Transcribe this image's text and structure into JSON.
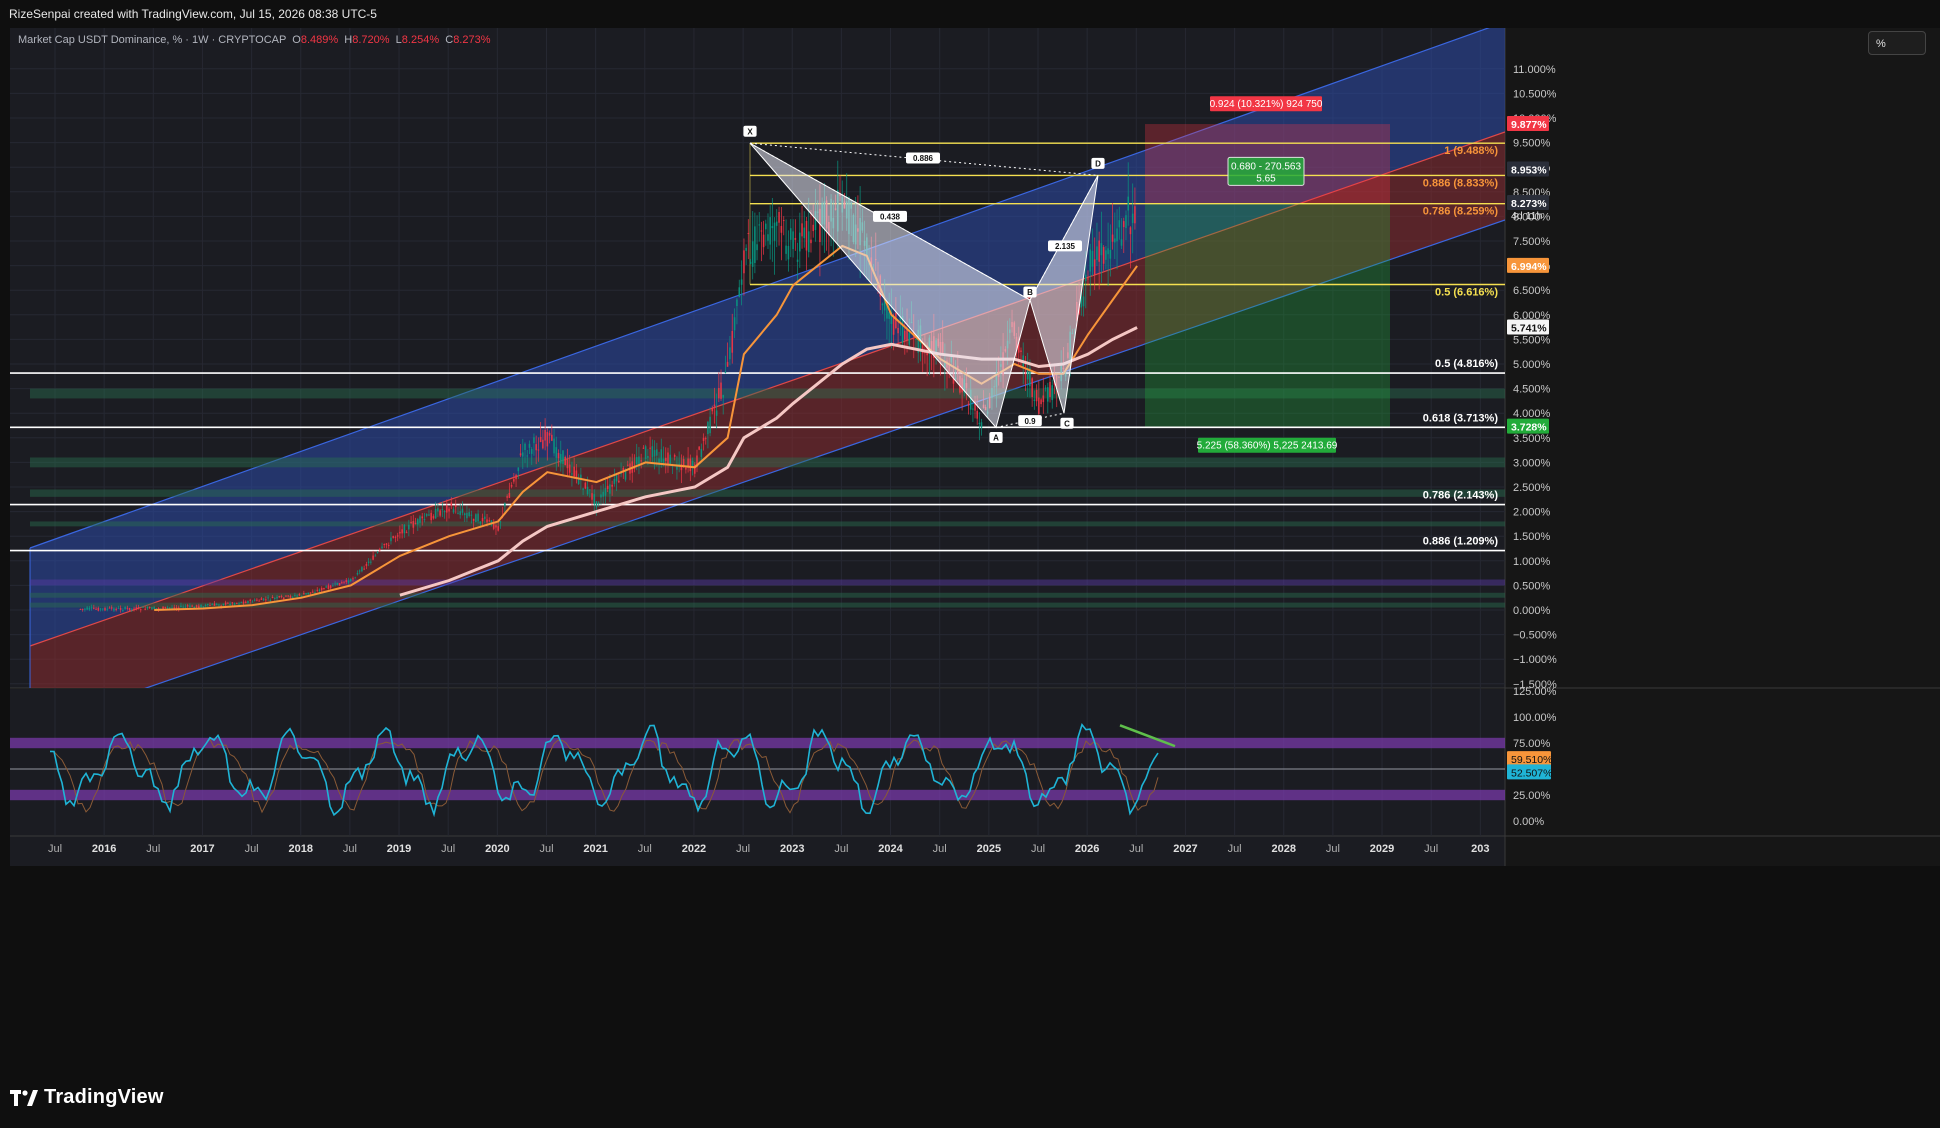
{
  "header": {
    "credit": "RizeSenpai created with TradingView.com, Jul 15, 2026 08:38 UTC-5"
  },
  "legend": {
    "symbol": "Market Cap USDT Dominance, % · 1W · CRYPTOCAP",
    "o_label": "O",
    "o": "8.489%",
    "h_label": "H",
    "h": "8.720%",
    "l_label": "L",
    "l": "8.254%",
    "c_label": "C",
    "c": "8.273%"
  },
  "scale_button": "%",
  "footer": {
    "brand": "TradingView"
  },
  "colors": {
    "background": "#1b1c22",
    "up": "#089981",
    "down": "#f23645",
    "channel_upper": "#2c4ba8",
    "channel_lower": "#8b2b2f",
    "ma_fast": "#f7953a",
    "ma_slow": "#f5c7c4",
    "fib": "#f5e050",
    "rsi": "#1fb4d6",
    "rsi_band": "#7e3ab0"
  },
  "chart_data": {
    "type": "line",
    "title": "Market Cap USDT Dominance, % · 1W · CRYPTOCAP",
    "x": [
      "2015-10",
      "2016-01",
      "2016-07",
      "2017-01",
      "2017-07",
      "2018-01",
      "2018-07",
      "2019-01",
      "2019-07",
      "2020-01",
      "2020-04",
      "2020-07",
      "2021-01",
      "2021-07",
      "2022-01",
      "2022-05",
      "2022-07",
      "2022-11",
      "2023-01",
      "2023-07",
      "2023-10",
      "2024-01",
      "2024-07",
      "2024-12",
      "2025-01",
      "2025-04",
      "2025-07",
      "2025-10",
      "2026-01",
      "2026-04",
      "2026-07"
    ],
    "series": [
      {
        "values": [
          0.02,
          0.02,
          0.03,
          0.08,
          0.18,
          0.3,
          0.6,
          1.6,
          2.1,
          1.7,
          3.2,
          3.5,
          2.2,
          3.2,
          2.9,
          4.8,
          7.2,
          7.8,
          7.4,
          8.2,
          7.5,
          5.8,
          5.3,
          3.9,
          4.2,
          5.7,
          4.1,
          4.8,
          6.9,
          7.5,
          8.27
        ]
      },
      {
        "values": [
          null,
          null,
          0.0,
          0.03,
          0.1,
          0.25,
          0.5,
          1.1,
          1.5,
          1.8,
          2.4,
          2.8,
          2.6,
          3.0,
          2.9,
          3.5,
          5.2,
          6.0,
          6.6,
          7.4,
          7.2,
          6.0,
          5.1,
          4.6,
          4.7,
          5.0,
          4.8,
          4.8,
          5.6,
          6.3,
          6.994
        ]
      },
      {
        "values": [
          null,
          null,
          null,
          null,
          null,
          null,
          null,
          0.3,
          0.6,
          1.0,
          1.4,
          1.7,
          2.0,
          2.3,
          2.5,
          2.9,
          3.5,
          3.9,
          4.2,
          5.0,
          5.3,
          5.4,
          5.2,
          5.1,
          5.1,
          5.1,
          4.95,
          5.0,
          5.2,
          5.5,
          5.741
        ]
      }
    ],
    "y_ticks": [
      "11.000%",
      "10.500%",
      "10.000%",
      "9.500%",
      "9.000%",
      "8.500%",
      "8.000%",
      "7.500%",
      "7.000%",
      "6.500%",
      "6.000%",
      "5.500%",
      "5.000%",
      "4.500%",
      "4.000%",
      "3.500%",
      "3.000%",
      "2.500%",
      "2.000%",
      "1.500%",
      "1.000%",
      "0.500%",
      "0.000%",
      "−0.500%",
      "−1.000%",
      "−1.500%"
    ],
    "x_ticks": [
      "Jul",
      "2016",
      "Jul",
      "2017",
      "Jul",
      "2018",
      "Jul",
      "2019",
      "Jul",
      "2020",
      "Jul",
      "2021",
      "Jul",
      "2022",
      "Jul",
      "2023",
      "Jul",
      "2024",
      "Jul",
      "2025",
      "Jul",
      "2026",
      "Jul",
      "2027",
      "Jul",
      "2028",
      "Jul",
      "2029",
      "Jul",
      "203"
    ],
    "price_badges": [
      {
        "value": 9.877,
        "text": "9.877%",
        "color": "#f23645"
      },
      {
        "value": 8.953,
        "text": "8.953%",
        "color": "#2a2e39"
      },
      {
        "value": 8.273,
        "text": "8.273%",
        "color": "#2a2e39"
      },
      {
        "value": 6.994,
        "text": "6.994%",
        "color": "#f7953a"
      },
      {
        "value": 5.741,
        "text": "5.741%",
        "color": "#f5f5f5"
      },
      {
        "value": 3.728,
        "text": "3.728%",
        "color": "#22ab3a"
      }
    ],
    "countdown": "4d 11h",
    "fib_upper": [
      {
        "value": 9.488,
        "text": "1 (9.488%)",
        "color": "#f7953a"
      },
      {
        "value": 8.833,
        "text": "0.886 (8.833%)",
        "color": "#f7953a"
      },
      {
        "value": 8.259,
        "text": "0.786 (8.259%)",
        "color": "#f7953a"
      },
      {
        "value": 6.616,
        "text": "0.5 (6.616%)",
        "color": "#f5e050"
      }
    ],
    "fib_lower": [
      {
        "value": 4.816,
        "text": "0.5 (4.816%)"
      },
      {
        "value": 3.713,
        "text": "0.618 (3.713%)"
      },
      {
        "value": 2.143,
        "text": "0.786 (2.143%)"
      },
      {
        "value": 1.209,
        "text": "0.886 (1.209%)"
      }
    ],
    "pattern_points": [
      "X",
      "A",
      "B",
      "C",
      "D"
    ],
    "pattern_ratios": [
      "0.886",
      "0.438",
      "2.135",
      "0.9"
    ],
    "position": {
      "stop_label": "0.924 (10.321%) 924 750",
      "entry_label": "0.680 - 270.563",
      "entry_sub": "5.65",
      "target_label": "5.225 (58.360%) 5,225 2413.69"
    },
    "rsi": {
      "y_ticks": [
        "125.00%",
        "100.00%",
        "75.00%",
        "50.00%",
        "25.00%",
        "0.00%"
      ],
      "badges": [
        {
          "text": "59.510%",
          "color": "#f7953a"
        },
        {
          "text": "52.507%",
          "color": "#1fb4d6"
        }
      ]
    },
    "grid": true,
    "legend_position": "top-left"
  }
}
